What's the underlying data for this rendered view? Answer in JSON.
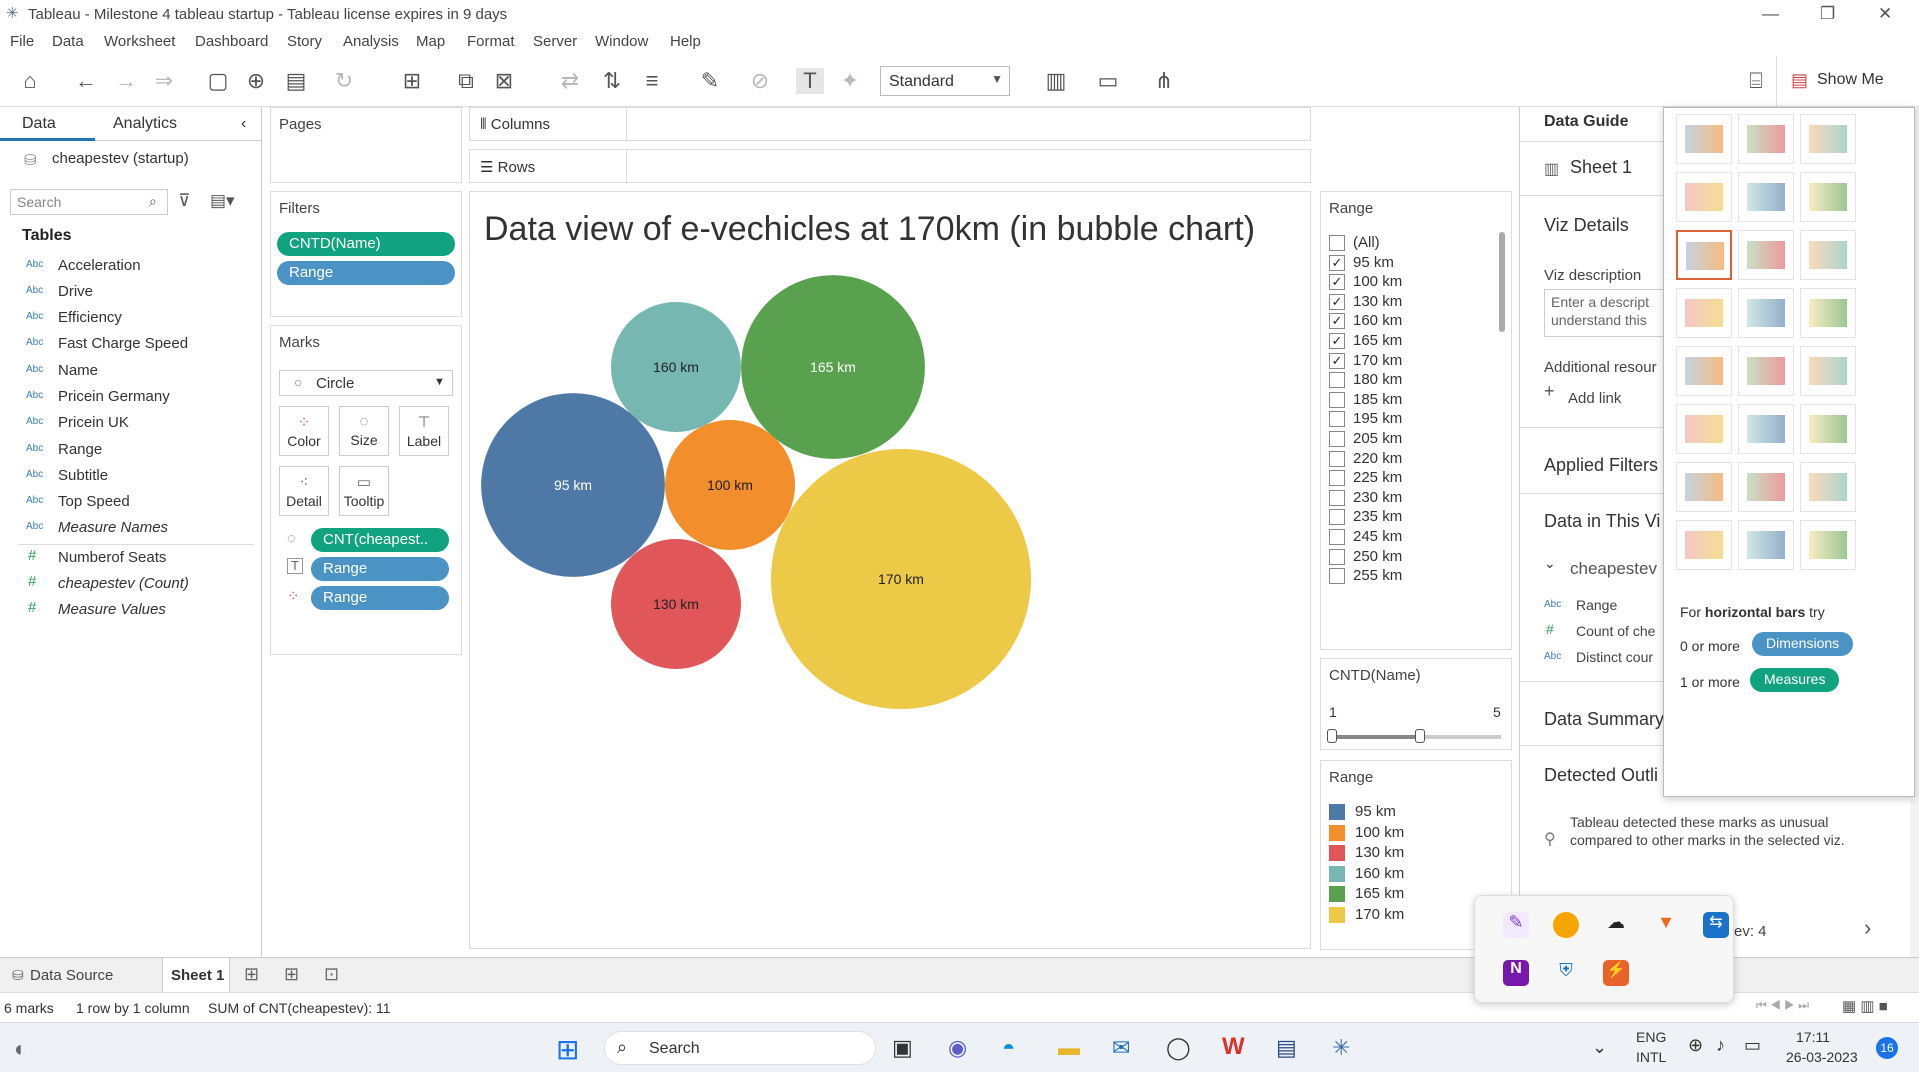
{
  "window": {
    "title": "Tableau - Milestone 4 tableau startup - Tableau license expires in 9 days"
  },
  "menu": [
    "File",
    "Data",
    "Worksheet",
    "Dashboard",
    "Story",
    "Analysis",
    "Map",
    "Format",
    "Server",
    "Window",
    "Help"
  ],
  "toolbar": {
    "fit_value": "Standard",
    "show_me_label": "Show Me"
  },
  "left_pane": {
    "tabs": [
      "Data",
      "Analytics"
    ],
    "datasource": "cheapestev (startup)",
    "search_placeholder": "Search",
    "tables_heading": "Tables",
    "dimensions": [
      {
        "type": "Abc",
        "name": "Acceleration"
      },
      {
        "type": "Abc",
        "name": "Drive"
      },
      {
        "type": "Abc",
        "name": "Efficiency"
      },
      {
        "type": "Abc",
        "name": "Fast Charge Speed"
      },
      {
        "type": "Abc",
        "name": "Name"
      },
      {
        "type": "Abc",
        "name": "Pricein Germany"
      },
      {
        "type": "Abc",
        "name": "Pricein UK"
      },
      {
        "type": "Abc",
        "name": "Range"
      },
      {
        "type": "Abc",
        "name": "Subtitle"
      },
      {
        "type": "Abc",
        "name": "Top Speed"
      },
      {
        "type": "Abc",
        "name": "Measure Names"
      }
    ],
    "measures": [
      {
        "type": "#",
        "name": "Numberof Seats"
      },
      {
        "type": "#",
        "name": "cheapestev (Count)"
      },
      {
        "type": "#",
        "name": "Measure Values"
      }
    ]
  },
  "pages": {
    "label": "Pages"
  },
  "filters": {
    "label": "Filters",
    "pills": [
      "CNTD(Name)",
      "Range"
    ]
  },
  "marks": {
    "label": "Marks",
    "type": "Circle",
    "buttons": [
      "Color",
      "Size",
      "Label",
      "Detail",
      "Tooltip"
    ],
    "pills": [
      "CNT(cheapest..",
      "Range",
      "Range"
    ]
  },
  "shelves": {
    "columns": "Columns",
    "rows": "Rows"
  },
  "viz": {
    "title": "Data view of e-vechicles at 170km (in bubble chart)"
  },
  "chart_data": {
    "type": "bubble",
    "title": "Data view of e-vechicles at 170km (in bubble chart)",
    "categories": [
      "95 km",
      "100 km",
      "130 km",
      "160 km",
      "165 km",
      "170 km"
    ],
    "values": [
      2,
      1,
      1,
      1,
      2,
      4
    ],
    "colors": [
      "#4e79a7",
      "#f28e2b",
      "#e15759",
      "#76b7b2",
      "#59a14f",
      "#edc948"
    ]
  },
  "range_filter": {
    "title": "Range",
    "items": [
      {
        "label": "(All)",
        "checked": false
      },
      {
        "label": "95 km",
        "checked": true
      },
      {
        "label": "100 km",
        "checked": true
      },
      {
        "label": "130 km",
        "checked": true
      },
      {
        "label": "160 km",
        "checked": true
      },
      {
        "label": "165 km",
        "checked": true
      },
      {
        "label": "170 km",
        "checked": true
      },
      {
        "label": "180 km",
        "checked": false
      },
      {
        "label": "185 km",
        "checked": false
      },
      {
        "label": "195 km",
        "checked": false
      },
      {
        "label": "205 km",
        "checked": false
      },
      {
        "label": "220 km",
        "checked": false
      },
      {
        "label": "225 km",
        "checked": false
      },
      {
        "label": "230 km",
        "checked": false
      },
      {
        "label": "235 km",
        "checked": false
      },
      {
        "label": "245 km",
        "checked": false
      },
      {
        "label": "250 km",
        "checked": false
      },
      {
        "label": "255 km",
        "checked": false
      }
    ]
  },
  "cntd_filter": {
    "title": "CNTD(Name)",
    "min": "1",
    "max": "5"
  },
  "legend": {
    "title": "Range",
    "items": [
      {
        "label": "95 km",
        "color": "#4e79a7"
      },
      {
        "label": "100 km",
        "color": "#f28e2b"
      },
      {
        "label": "130 km",
        "color": "#e15759"
      },
      {
        "label": "160 km",
        "color": "#76b7b2"
      },
      {
        "label": "165 km",
        "color": "#59a14f"
      },
      {
        "label": "170 km",
        "color": "#edc948"
      }
    ]
  },
  "guide": {
    "title": "Data Guide",
    "sheet": "Sheet 1",
    "viz_details": "Viz Details",
    "viz_description": "Viz description",
    "desc_placeholder_1": "Enter a descript",
    "desc_placeholder_2": "understand this",
    "additional": "Additional resour",
    "add_link": "Add link",
    "applied_filters": "Applied Filters",
    "data_in_viz": "Data in This Vi",
    "source": "cheapestev",
    "fields": [
      {
        "type": "Abc",
        "name": "Range"
      },
      {
        "type": "#",
        "name": "Count of che"
      },
      {
        "type": "Abc",
        "name": "Distinct cour"
      }
    ],
    "data_summary": "Data Summary",
    "detected_outliers": "Detected Outli",
    "outlier_text": "Tableau detected these marks as unusual compared to other marks in the selected viz.",
    "ev_count": "ev: 4"
  },
  "show_me": {
    "hint_prefix": "For ",
    "hint_bold": "horizontal bars",
    "hint_suffix": " try",
    "req1_prefix": "0 or more",
    "req1_pill": "Dimensions",
    "req2_prefix": "1 or more",
    "req2_pill": "Measures"
  },
  "bottom_tabs": {
    "data_source": "Data Source",
    "sheet": "Sheet 1"
  },
  "status": {
    "marks": "6 marks",
    "grid": "1 row by 1 column",
    "sum": "SUM of CNT(cheapestev): 11"
  },
  "taskbar": {
    "search": "Search",
    "lang1": "ENG",
    "lang2": "INTL",
    "time": "17:11",
    "date": "26-03-2023",
    "badge": "16"
  }
}
